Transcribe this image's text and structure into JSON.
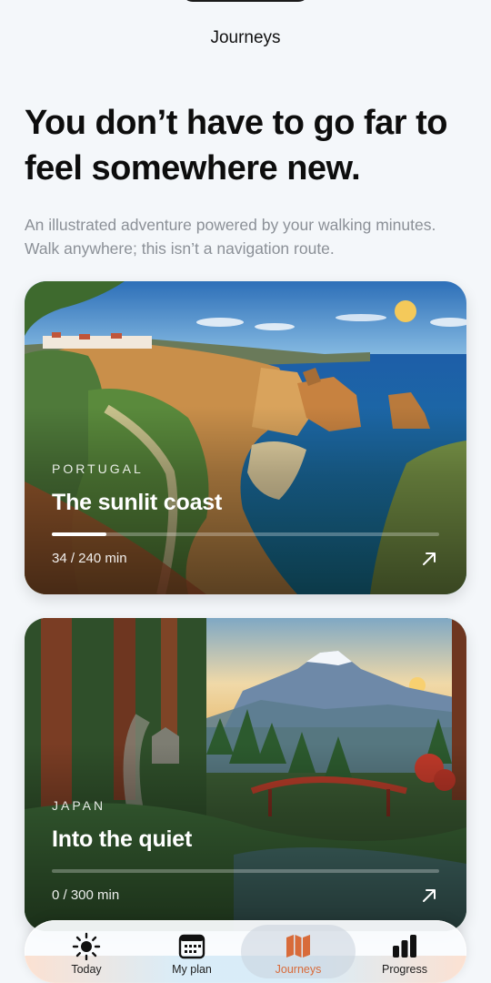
{
  "nav": {
    "title": "Journeys"
  },
  "hero": {
    "headline": "You don’t have to go far to feel somewhere new.",
    "subtitle": "An illustrated adventure powered by your walking minutes. Walk anywhere; this isn’t a navigation route."
  },
  "journeys": [
    {
      "country": "PORTUGAL",
      "title": "The sunlit coast",
      "minutes_text": "34 / 240 min",
      "progress": 0.1417,
      "icon": "arrow-up-right-icon"
    },
    {
      "country": "JAPAN",
      "title": "Into the quiet",
      "minutes_text": "0 / 300 min",
      "progress": 0,
      "icon": "arrow-up-right-icon"
    }
  ],
  "tabbar": {
    "tabs": [
      {
        "label": "Today",
        "icon": "sun-icon",
        "active": false
      },
      {
        "label": "My plan",
        "icon": "calendar-icon",
        "active": false
      },
      {
        "label": "Journeys",
        "icon": "map-icon",
        "active": true
      },
      {
        "label": "Progress",
        "icon": "bar-chart-icon",
        "active": false
      }
    ]
  },
  "colors": {
    "background": "#f4f7fa",
    "accent": "#d86b3a",
    "subtitle": "#8b9097"
  }
}
